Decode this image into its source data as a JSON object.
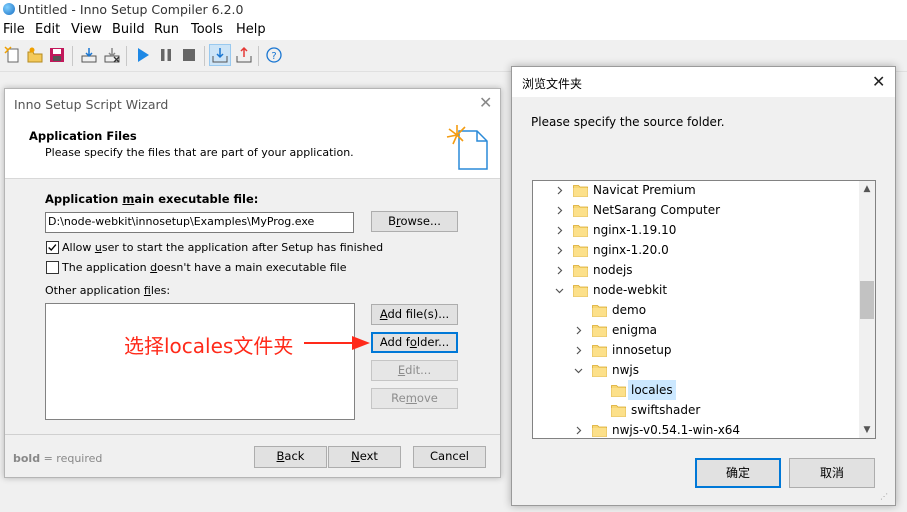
{
  "app": {
    "title": "Untitled - Inno Setup Compiler 6.2.0",
    "menu": [
      "File",
      "Edit",
      "View",
      "Build",
      "Run",
      "Tools",
      "Help"
    ]
  },
  "toolbar": {
    "icons": [
      "new-file-icon",
      "open-file-icon",
      "save-icon",
      "compile-icon",
      "stop-compile-icon",
      "run-icon",
      "pause-icon",
      "stop-icon",
      "target-setup-icon",
      "target-uninstall-icon",
      "help-icon"
    ]
  },
  "wizard": {
    "title": "Inno Setup Script Wizard",
    "heading": "Application Files",
    "subheading": "Please specify the files that are part of your application.",
    "main_exe_label": "Application main executable file:",
    "main_exe_value": "D:\\node-webkit\\innosetup\\Examples\\MyProg.exe",
    "browse_label": "Browse...",
    "allow_user_label": "Allow user to start the application after Setup has finished",
    "allow_user_checked": true,
    "no_main_exe_label": "The application doesn't have a main executable file",
    "no_main_exe_checked": false,
    "other_files_label": "Other application files:",
    "add_files_label": "Add file(s)...",
    "add_folder_label": "Add folder...",
    "edit_label": "Edit...",
    "remove_label": "Remove",
    "bold_note_bold": "bold",
    "bold_note_rest": " = required",
    "back_label": "Back",
    "next_label": "Next",
    "cancel_label": "Cancel"
  },
  "annotation": {
    "text": "选择locales文件夹",
    "color": "#ff2a1a"
  },
  "browse_dialog": {
    "title": "浏览文件夹",
    "prompt": "Please specify the source folder.",
    "tree": [
      {
        "label": "Navicat Premium",
        "level": 0,
        "expander": "collapsed"
      },
      {
        "label": "NetSarang Computer",
        "level": 0,
        "expander": "collapsed"
      },
      {
        "label": "nginx-1.19.10",
        "level": 0,
        "expander": "collapsed"
      },
      {
        "label": "nginx-1.20.0",
        "level": 0,
        "expander": "collapsed"
      },
      {
        "label": "nodejs",
        "level": 0,
        "expander": "collapsed"
      },
      {
        "label": "node-webkit",
        "level": 0,
        "expander": "expanded"
      },
      {
        "label": "demo",
        "level": 1,
        "expander": "none"
      },
      {
        "label": "enigma",
        "level": 1,
        "expander": "collapsed"
      },
      {
        "label": "innosetup",
        "level": 1,
        "expander": "collapsed"
      },
      {
        "label": "nwjs",
        "level": 1,
        "expander": "expanded"
      },
      {
        "label": "locales",
        "level": 2,
        "expander": "none",
        "selected": true
      },
      {
        "label": "swiftshader",
        "level": 2,
        "expander": "none"
      },
      {
        "label": "nwjs-v0.54.1-win-x64",
        "level": 1,
        "expander": "collapsed"
      }
    ],
    "ok_label": "确定",
    "cancel_label": "取消"
  }
}
